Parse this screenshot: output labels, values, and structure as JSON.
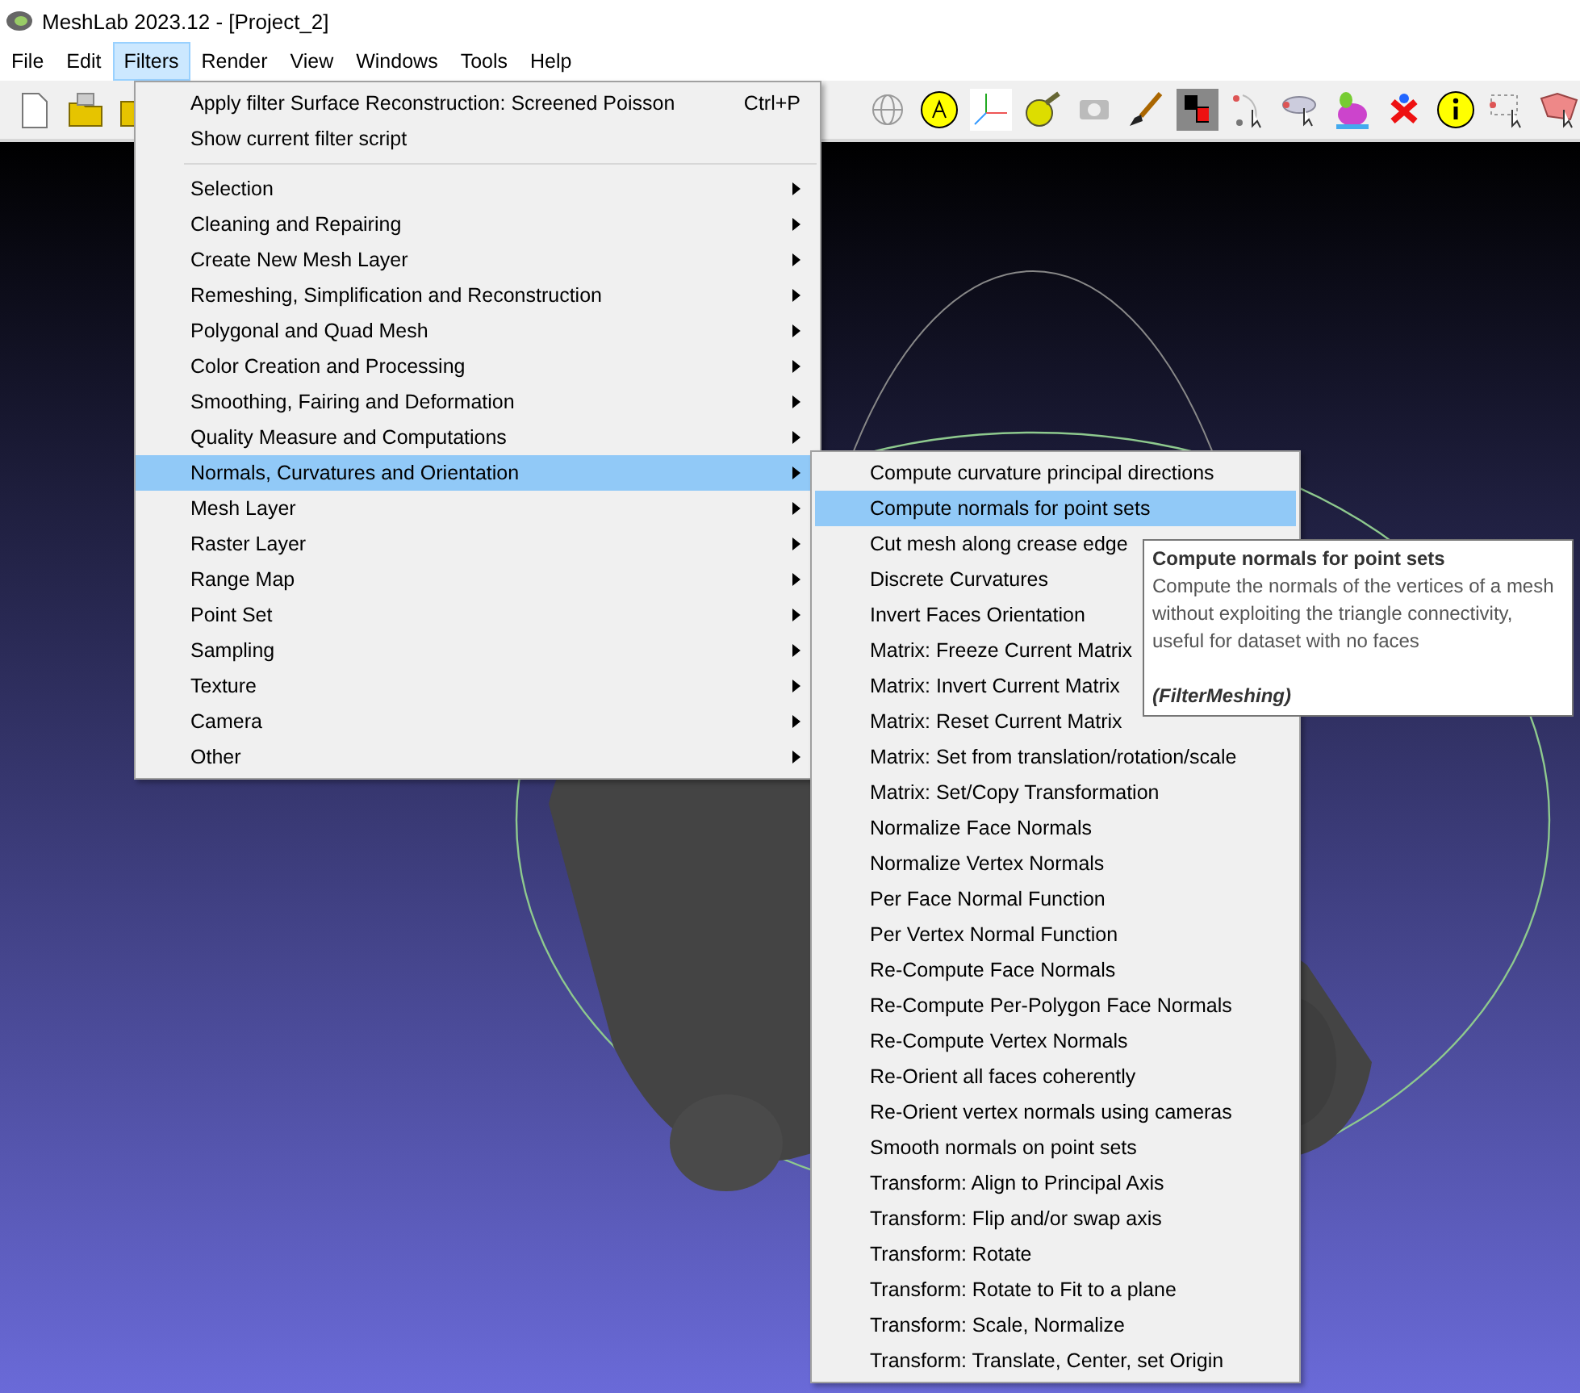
{
  "window": {
    "title": "MeshLab 2023.12 - [Project_2]"
  },
  "menubar": [
    {
      "label": "File",
      "selected": false
    },
    {
      "label": "Edit",
      "selected": false
    },
    {
      "label": "Filters",
      "selected": true
    },
    {
      "label": "Render",
      "selected": false
    },
    {
      "label": "View",
      "selected": false
    },
    {
      "label": "Windows",
      "selected": false
    },
    {
      "label": "Tools",
      "selected": false
    },
    {
      "label": "Help",
      "selected": false
    }
  ],
  "filters_menu": [
    {
      "kind": "item",
      "label": "Apply filter Surface Reconstruction: Screened Poisson",
      "shortcut": "Ctrl+P",
      "selected": false
    },
    {
      "kind": "item",
      "label": "Show current filter script",
      "selected": false
    },
    {
      "kind": "separator"
    },
    {
      "kind": "submenu",
      "label": "Selection",
      "selected": false
    },
    {
      "kind": "submenu",
      "label": "Cleaning and Repairing",
      "selected": false
    },
    {
      "kind": "submenu",
      "label": "Create New Mesh Layer",
      "selected": false
    },
    {
      "kind": "submenu",
      "label": "Remeshing, Simplification and Reconstruction",
      "selected": false
    },
    {
      "kind": "submenu",
      "label": "Polygonal and Quad Mesh",
      "selected": false
    },
    {
      "kind": "submenu",
      "label": "Color Creation and Processing",
      "selected": false
    },
    {
      "kind": "submenu",
      "label": "Smoothing, Fairing and Deformation",
      "selected": false
    },
    {
      "kind": "submenu",
      "label": "Quality Measure and Computations",
      "selected": false
    },
    {
      "kind": "submenu",
      "label": "Normals, Curvatures and Orientation",
      "selected": true
    },
    {
      "kind": "submenu",
      "label": "Mesh Layer",
      "selected": false
    },
    {
      "kind": "submenu",
      "label": "Raster Layer",
      "selected": false
    },
    {
      "kind": "submenu",
      "label": "Range Map",
      "selected": false
    },
    {
      "kind": "submenu",
      "label": "Point Set",
      "selected": false
    },
    {
      "kind": "submenu",
      "label": "Sampling",
      "selected": false
    },
    {
      "kind": "submenu",
      "label": "Texture",
      "selected": false
    },
    {
      "kind": "submenu",
      "label": "Camera",
      "selected": false
    },
    {
      "kind": "submenu",
      "label": "Other",
      "selected": false
    }
  ],
  "submenu": [
    {
      "label": "Compute curvature principal directions",
      "selected": false
    },
    {
      "label": "Compute normals for point sets",
      "selected": true
    },
    {
      "label": "Cut mesh along crease edge",
      "selected": false
    },
    {
      "label": "Discrete Curvatures",
      "selected": false
    },
    {
      "label": "Invert Faces Orientation",
      "selected": false
    },
    {
      "label": "Matrix: Freeze Current Matrix",
      "selected": false
    },
    {
      "label": "Matrix: Invert Current Matrix",
      "selected": false
    },
    {
      "label": "Matrix: Reset Current Matrix",
      "selected": false
    },
    {
      "label": "Matrix: Set from translation/rotation/scale",
      "selected": false
    },
    {
      "label": "Matrix: Set/Copy Transformation",
      "selected": false
    },
    {
      "label": "Normalize Face Normals",
      "selected": false
    },
    {
      "label": "Normalize Vertex Normals",
      "selected": false
    },
    {
      "label": "Per Face Normal Function",
      "selected": false
    },
    {
      "label": "Per Vertex Normal Function",
      "selected": false
    },
    {
      "label": "Re-Compute Face Normals",
      "selected": false
    },
    {
      "label": "Re-Compute Per-Polygon Face Normals",
      "selected": false
    },
    {
      "label": "Re-Compute Vertex Normals",
      "selected": false
    },
    {
      "label": "Re-Orient all faces coherently",
      "selected": false
    },
    {
      "label": "Re-Orient vertex normals using cameras",
      "selected": false
    },
    {
      "label": "Smooth normals on point sets",
      "selected": false
    },
    {
      "label": "Transform: Align to Principal Axis",
      "selected": false
    },
    {
      "label": "Transform: Flip and/or swap axis",
      "selected": false
    },
    {
      "label": "Transform: Rotate",
      "selected": false
    },
    {
      "label": "Transform: Rotate to Fit to a plane",
      "selected": false
    },
    {
      "label": "Transform: Scale, Normalize",
      "selected": false
    },
    {
      "label": "Transform: Translate, Center, set Origin",
      "selected": false
    }
  ],
  "tooltip": {
    "title": "Compute normals for point sets",
    "body": "Compute the normals of the vertices of a mesh without exploiting the triangle connectivity, useful for dataset with no faces",
    "source": "(FilterMeshing)"
  }
}
